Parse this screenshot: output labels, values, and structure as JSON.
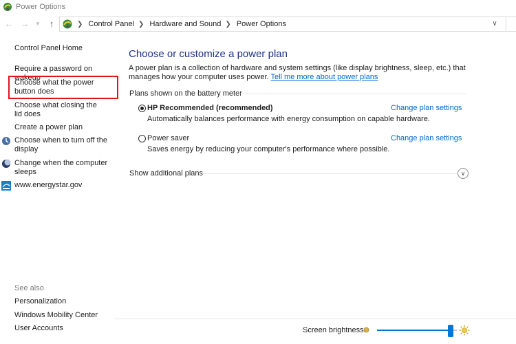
{
  "window": {
    "title": "Power Options"
  },
  "nav": {
    "back_icon": "back-arrow-icon",
    "forward_icon": "forward-arrow-icon",
    "up_icon": "up-arrow-icon",
    "breadcrumbs": [
      "Control Panel",
      "Hardware and Sound",
      "Power Options"
    ]
  },
  "sidebar": {
    "home": "Control Panel Home",
    "links": [
      "Require a password on wakeup",
      "Choose what the power button does",
      "Choose what closing the lid does",
      "Create a power plan"
    ],
    "icon_links": [
      {
        "label": "Choose when to turn off the display",
        "icon": "display-icon"
      },
      {
        "label": "Change when the computer sleeps",
        "icon": "moon-icon"
      },
      {
        "label": "www.energystar.gov",
        "icon": "energystar-icon"
      }
    ],
    "see_also_title": "See also",
    "see_also": [
      "Personalization",
      "Windows Mobility Center",
      "User Accounts"
    ]
  },
  "main": {
    "title": "Choose or customize a power plan",
    "description": "A power plan is a collection of hardware and system settings (like display brightness, sleep, etc.) that manages how your computer uses power.",
    "learn_more": "Tell me more about power plans",
    "section_header": "Plans shown on the battery meter",
    "plans": [
      {
        "name": "HP Recommended (recommended)",
        "description": "Automatically balances performance with energy consumption on capable hardware.",
        "link": "Change plan settings",
        "selected": true
      },
      {
        "name": "Power saver",
        "description": "Saves energy by reducing your computer's performance where possible.",
        "link": "Change plan settings",
        "selected": false
      }
    ],
    "show_additional": "Show additional plans"
  },
  "bottom": {
    "brightness_label": "Screen brightness:",
    "brightness_value": 0.92
  },
  "colors": {
    "link": "#0066cc",
    "title": "#1e3287",
    "highlight": "#e3121f",
    "accent": "#0078d7"
  }
}
